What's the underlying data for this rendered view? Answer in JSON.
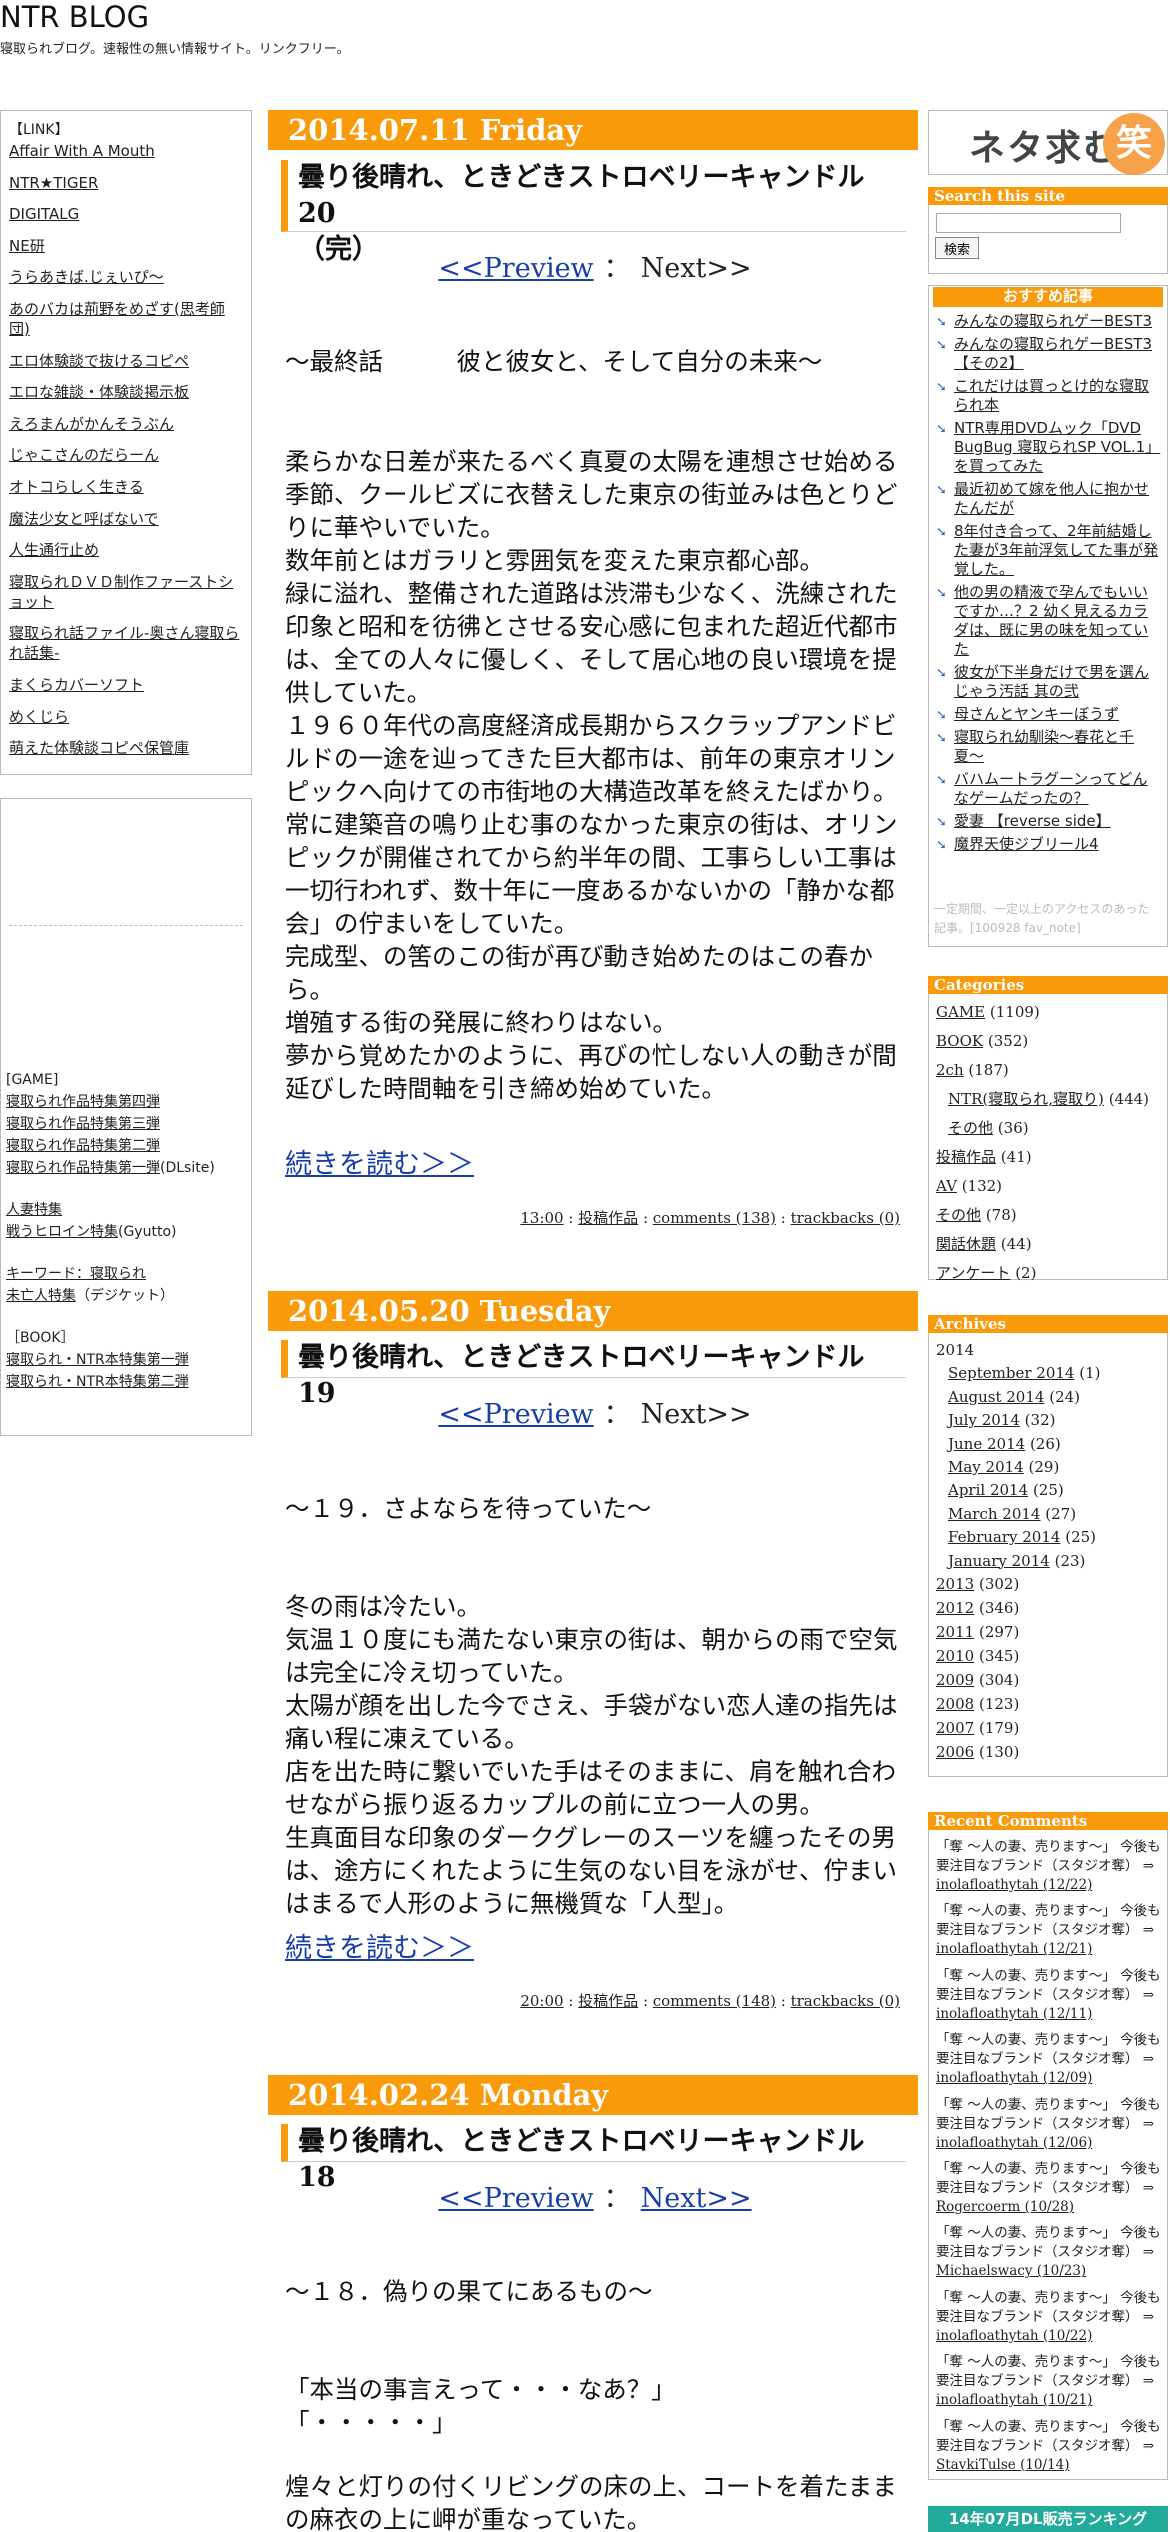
{
  "site": {
    "title": "NTR BLOG",
    "description": "寝取られブログ。速報性の無い情報サイト。リンクフリー。"
  },
  "links": {
    "header": "【LINK】",
    "items": [
      "Affair With A Mouth",
      "NTR★TIGER",
      "DIGITALG",
      "NE研",
      "うらあきば.じぇいぴ〜",
      "あのバカは荊野をめざす(思考師団)",
      "エロ体験談で抜けるコピペ",
      "エロな雑談・体験談掲示板",
      "えろまんがかんそうぶん",
      "じゃこさんのだらーん",
      "オトコらしく生きる",
      "魔法少女と呼ばないで",
      "人生通行止め",
      "寝取られＤＶＤ制作ファーストショット",
      "寝取られ話ファイル-奥さん寝取られ話集-",
      "まくらカバーソフト",
      "めくじら",
      "萌えた体験談コピペ保管庫"
    ]
  },
  "misc": {
    "game_header": "[GAME]",
    "game_items": [
      "寝取られ作品特集第四弾",
      "寝取られ作品特集第三弾",
      "寝取られ作品特集第二弾",
      "寝取られ作品特集第一弾"
    ],
    "game_suffix": "(DLsite)",
    "wife_items": [
      "人妻特集"
    ],
    "heroine_link": "戦うヒロイン特集",
    "heroine_suffix": "(Gyutto)",
    "keyword_link": "キーワード：寝取られ",
    "widow_link": "未亡人特集",
    "widow_suffix": "（デジケット）",
    "book_header": "［BOOK］",
    "book_items": [
      "寝取られ・NTR本特集第一弾",
      "寝取られ・NTR本特集第二弾"
    ]
  },
  "entries": [
    {
      "date": "2014.07.11 Friday",
      "title_line1": "曇り後晴れ、ときどきストロベリーキャンドル 20",
      "title_line2": "（完）",
      "preview": "<<Preview",
      "sep": "：",
      "next": "Next>>",
      "subtitle": "〜最終話　　　彼と彼女と、そして自分の未来〜",
      "paragraphs": [
        "柔らかな日差が来たるべく真夏の太陽を連想させ始める季節、クールビズに衣替えした東京の街並みは色とりどりに華やいでいた。",
        "数年前とはガラリと雰囲気を変えた東京都心部。",
        "緑に溢れ、整備された道路は渋滞も少なく、洗練された印象と昭和を彷彿とさせる安心感に包まれた超近代都市は、全ての人々に優しく、そして居心地の良い環境を提供していた。",
        "１９６０年代の高度経済成長期からスクラップアンドビルドの一途を辿ってきた巨大都市は、前年の東京オリンピックへ向けての市街地の大構造改革を終えたばかり。",
        "常に建築音の鳴り止む事のなかった東京の街は、オリンピックが開催されてから約半年の間、工事らしい工事は一切行われず、数十年に一度あるかないかの「静かな都会」の佇まいをしていた。",
        "完成型、の筈のこの街が再び動き始めたのはこの春から。",
        "増殖する街の発展に終わりはない。",
        "夢から覚めたかのように、再びの忙しない人の動きが間延びした時間軸を引き締め始めていた。"
      ],
      "read_more": "続きを読む＞＞",
      "time": "13:00",
      "category": "投稿作品",
      "comments": "comments (138)",
      "trackbacks": "trackbacks (0)"
    },
    {
      "date": "2014.05.20 Tuesday",
      "title_line1": "曇り後晴れ、ときどきストロベリーキャンドル 19",
      "preview": "<<Preview",
      "sep": "：",
      "next": "Next>>",
      "subtitle": "〜１９．さよならを待っていた〜",
      "paragraphs": [
        "冬の雨は冷たい。",
        "気温１０度にも満たない東京の街は、朝からの雨で空気は完全に冷え切っていた。",
        "太陽が顔を出した今でさえ、手袋がない恋人達の指先は痛い程に凍えている。",
        "店を出た時に繋いでいた手はそのままに、肩を触れ合わせながら振り返るカップルの前に立つ一人の男。",
        "生真面目な印象のダークグレーのスーツを纏ったその男は、途方にくれたように生気のない目を泳がせ、佇まいはまるで人形のように無機質な「人型」。"
      ],
      "read_more": "続きを読む＞＞",
      "time": "20:00",
      "category": "投稿作品",
      "comments": "comments (148)",
      "trackbacks": "trackbacks (0)"
    },
    {
      "date": "2014.02.24 Monday",
      "title_line1": "曇り後晴れ、ときどきストロベリーキャンドル 18",
      "preview": "<<Preview",
      "sep": "：",
      "next": "Next>>",
      "subtitle": "〜１８．偽りの果てにあるもの〜",
      "dialogue": [
        "「本当の事言えって・・・なあ？」",
        "「・・・・・」"
      ],
      "paragraphs": [
        "煌々と灯りの付くリビングの床の上、コートを着たままの麻衣の上に岬が重なっていた。"
      ]
    }
  ],
  "sidebar": {
    "banner_text": "ネタ求む",
    "banner_icon_char": "笑",
    "search_header": "Search this site",
    "search_button": "検索",
    "reco_header": "おすすめ記事",
    "reco_items": [
      "みんなの寝取られゲーBEST3",
      "みんなの寝取られゲーBEST3【その2】",
      "これだけは買っとけ的な寝取られ本",
      "NTR専用DVDムック「DVD BugBug 寝取られSP VOL.1」を買ってみた",
      "最近初めて嫁を他人に抱かせたんだが",
      "8年付き合って、2年前結婚した妻が3年前浮気してた事が発覚した。",
      "他の男の精液で孕んでもいいですか…？2 幼く見えるカラダは、既に男の味を知っていた",
      "彼女が下半身だけで男を選んじゃう汚話 其の弐",
      "母さんとヤンキーぼうず",
      "寝取られ幼馴染〜春花と千夏〜",
      "バハムートラグーンってどんなゲームだったの？",
      "愛妻 【reverse side】",
      "魔界天使ジブリール4"
    ],
    "reco_note": "一定期間、一定以上のアクセスのあった記事。[100928 fav_note]",
    "categories_header": "Categories",
    "categories": [
      {
        "name": "GAME",
        "count": "(1109)",
        "sub": false
      },
      {
        "name": "BOOK",
        "count": "(352)",
        "sub": false
      },
      {
        "name": "2ch",
        "count": "(187)",
        "sub": false
      },
      {
        "name": "NTR(寝取られ,寝取り)",
        "count": "(444)",
        "sub": true
      },
      {
        "name": "その他",
        "count": "(36)",
        "sub": true
      },
      {
        "name": "投稿作品",
        "count": "(41)",
        "sub": false
      },
      {
        "name": "AV",
        "count": "(132)",
        "sub": false
      },
      {
        "name": "その他",
        "count": "(78)",
        "sub": false
      },
      {
        "name": "関話休題",
        "count": "(44)",
        "sub": false
      },
      {
        "name": "アンケート",
        "count": "(2)",
        "sub": false
      }
    ],
    "archives_header": "Archives",
    "archives_year": "2014",
    "archives_months": [
      {
        "name": "September 2014",
        "count": "(1)"
      },
      {
        "name": "August 2014",
        "count": "(24)"
      },
      {
        "name": "July 2014",
        "count": "(32)"
      },
      {
        "name": "June 2014",
        "count": "(26)"
      },
      {
        "name": "May 2014",
        "count": "(29)"
      },
      {
        "name": "April 2014",
        "count": "(25)"
      },
      {
        "name": "March 2014",
        "count": "(27)"
      },
      {
        "name": "February 2014",
        "count": "(25)"
      },
      {
        "name": "January 2014",
        "count": "(23)"
      }
    ],
    "archives_years": [
      {
        "name": "2013",
        "count": "(302)"
      },
      {
        "name": "2012",
        "count": "(346)"
      },
      {
        "name": "2011",
        "count": "(297)"
      },
      {
        "name": "2010",
        "count": "(345)"
      },
      {
        "name": "2009",
        "count": "(304)"
      },
      {
        "name": "2008",
        "count": "(123)"
      },
      {
        "name": "2007",
        "count": "(179)"
      },
      {
        "name": "2006",
        "count": "(130)"
      }
    ],
    "recent_header": "Recent Comments",
    "recent_comments": [
      {
        "text": "「奪 〜人の妻、売ります〜」 今後も要注目なブランド（スタジオ奪）",
        "author": "inolafloathytah (12/22)"
      },
      {
        "text": "「奪 〜人の妻、売ります〜」 今後も要注目なブランド（スタジオ奪）",
        "author": "inolafloathytah (12/21)"
      },
      {
        "text": "「奪 〜人の妻、売ります〜」 今後も要注目なブランド（スタジオ奪）",
        "author": "inolafloathytah (12/11)"
      },
      {
        "text": "「奪 〜人の妻、売ります〜」 今後も要注目なブランド（スタジオ奪）",
        "author": "inolafloathytah (12/09)"
      },
      {
        "text": "「奪 〜人の妻、売ります〜」 今後も要注目なブランド（スタジオ奪）",
        "author": "inolafloathytah (12/06)"
      },
      {
        "text": "「奪 〜人の妻、売ります〜」 今後も要注目なブランド（スタジオ奪）",
        "author": "Rogercoerm (10/28)"
      },
      {
        "text": "「奪 〜人の妻、売ります〜」 今後も要注目なブランド（スタジオ奪）",
        "author": "Michaelswacy (10/23)"
      },
      {
        "text": "「奪 〜人の妻、売ります〜」 今後も要注目なブランド（スタジオ奪）",
        "author": "inolafloathytah (10/22)"
      },
      {
        "text": "「奪 〜人の妻、売ります〜」 今後も要注目なブランド（スタジオ奪）",
        "author": "inolafloathytah (10/21)"
      },
      {
        "text": "「奪 〜人の妻、売ります〜」 今後も要注目なブランド（スタジオ奪）",
        "author": "StavkiTulse (10/14)"
      }
    ],
    "ranking_header": "14年07月DL販売ランキング"
  }
}
